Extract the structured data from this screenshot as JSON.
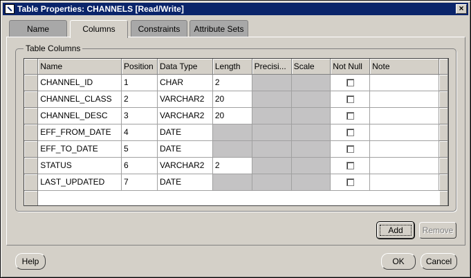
{
  "window": {
    "title": "Table Properties: CHANNELS [Read/Write]",
    "close_label": "×"
  },
  "tabs": [
    {
      "label": "Name",
      "active": false
    },
    {
      "label": "Columns",
      "active": true
    },
    {
      "label": "Constraints",
      "active": false
    },
    {
      "label": "Attribute Sets",
      "active": false
    }
  ],
  "group": {
    "label": "Table Columns"
  },
  "grid": {
    "headers": [
      "Name",
      "Position",
      "Data Type",
      "Length",
      "Precisi...",
      "Scale",
      "Not Null",
      "Note"
    ],
    "rows": [
      {
        "name": "CHANNEL_ID",
        "position": "1",
        "data_type": "CHAR",
        "length": "2",
        "not_null": false
      },
      {
        "name": "CHANNEL_CLASS",
        "position": "2",
        "data_type": "VARCHAR2",
        "length": "20",
        "not_null": false
      },
      {
        "name": "CHANNEL_DESC",
        "position": "3",
        "data_type": "VARCHAR2",
        "length": "20",
        "not_null": false
      },
      {
        "name": "EFF_FROM_DATE",
        "position": "4",
        "data_type": "DATE",
        "length": "",
        "not_null": false
      },
      {
        "name": "EFF_TO_DATE",
        "position": "5",
        "data_type": "DATE",
        "length": "",
        "not_null": false
      },
      {
        "name": "STATUS",
        "position": "6",
        "data_type": "VARCHAR2",
        "length": "2",
        "not_null": false
      },
      {
        "name": "LAST_UPDATED",
        "position": "7",
        "data_type": "DATE",
        "length": "",
        "not_null": false
      }
    ]
  },
  "buttons": {
    "add": "Add",
    "remove": "Remove",
    "help": "Help",
    "ok": "OK",
    "cancel": "Cancel"
  },
  "colors": {
    "titlebar": "#0a246a",
    "dialog_bg": "#d4d0c8",
    "disabled_cell": "#c4c3c4"
  }
}
